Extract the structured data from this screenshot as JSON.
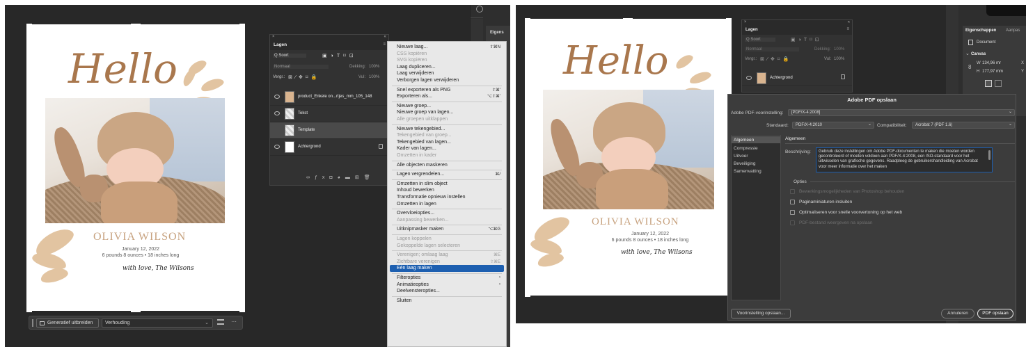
{
  "left_screen": {
    "artboard": {
      "hello": "Hello",
      "name": "OLIVIA WILSON",
      "date": "January 12, 2022",
      "details": "6 pounds 8 ounces • 18 inches long",
      "signature": "with love, The Wilsons"
    },
    "layers_panel": {
      "tab": "Lagen",
      "kind_filter": "Q Soort",
      "blend_mode": "Normaal",
      "opacity_label": "Dekking:",
      "opacity_value": "100%",
      "lock_label": "Vergr.:",
      "fill_label": "Vul:",
      "fill_value": "100%",
      "layers": [
        {
          "name": "product_Enkele on...rtjes_mm_105_148"
        },
        {
          "name": "Tekst"
        },
        {
          "name": "Template"
        },
        {
          "name": "Achtergrond"
        }
      ]
    },
    "context_menu": {
      "items": [
        {
          "label": "Nieuwe laag...",
          "shortcut": "⇧⌘N",
          "disabled": false
        },
        {
          "label": "CSS kopiëren",
          "shortcut": "",
          "disabled": true
        },
        {
          "label": "SVG kopiëren",
          "shortcut": "",
          "disabled": true
        },
        {
          "label": "Laag dupliceren...",
          "shortcut": "",
          "disabled": false
        },
        {
          "label": "Laag verwijderen",
          "shortcut": "",
          "disabled": false
        },
        {
          "label": "Verborgen lagen verwijderen",
          "shortcut": "",
          "disabled": false
        },
        {
          "label": "Snel exporteren als PNG",
          "shortcut": "⇧⌘'",
          "disabled": false
        },
        {
          "label": "Exporteren als...",
          "shortcut": "⌥⇧⌘'",
          "disabled": false
        },
        {
          "label": "Nieuwe groep...",
          "shortcut": "",
          "disabled": false
        },
        {
          "label": "Nieuwe groep van lagen...",
          "shortcut": "",
          "disabled": false
        },
        {
          "label": "Alle groepen uitklappen",
          "shortcut": "",
          "disabled": true
        },
        {
          "label": "Nieuwe tekengebied...",
          "shortcut": "",
          "disabled": false
        },
        {
          "label": "Tekengebied van groep...",
          "shortcut": "",
          "disabled": true
        },
        {
          "label": "Tekengebied van lagen...",
          "shortcut": "",
          "disabled": false
        },
        {
          "label": "Kader van lagen...",
          "shortcut": "",
          "disabled": false
        },
        {
          "label": "Omzetten in kader",
          "shortcut": "",
          "disabled": true
        },
        {
          "label": "Alle objecten maskeren",
          "shortcut": "",
          "disabled": false
        },
        {
          "label": "Lagen vergrendelen...",
          "shortcut": "⌘/",
          "disabled": false
        },
        {
          "label": "Omzetten in slim object",
          "shortcut": "",
          "disabled": false
        },
        {
          "label": "Inhoud bewerken",
          "shortcut": "",
          "disabled": false
        },
        {
          "label": "Transformatie opnieuw instellen",
          "shortcut": "",
          "disabled": false
        },
        {
          "label": "Omzetten in lagen",
          "shortcut": "",
          "disabled": false
        },
        {
          "label": "Overvloeiopties...",
          "shortcut": "",
          "disabled": false
        },
        {
          "label": "Aanpassing bewerken...",
          "shortcut": "",
          "disabled": true
        },
        {
          "label": "Uitknipmasker maken",
          "shortcut": "⌥⌘G",
          "disabled": false
        },
        {
          "label": "Lagen koppelen",
          "shortcut": "",
          "disabled": true
        },
        {
          "label": "Gekoppelde lagen selecteren",
          "shortcut": "",
          "disabled": true
        },
        {
          "label": "Verenigen; omlaag laag",
          "shortcut": "⌘E",
          "disabled": true
        },
        {
          "label": "Zichtbare verenigen",
          "shortcut": "⇧⌘E",
          "disabled": true
        },
        {
          "label": "Eén laag maken",
          "shortcut": "",
          "disabled": false
        },
        {
          "label": "Filteropties",
          "shortcut": "›",
          "disabled": false
        },
        {
          "label": "Animatieopties",
          "shortcut": "›",
          "disabled": false
        },
        {
          "label": "Deelvensteropties...",
          "shortcut": "",
          "disabled": false
        },
        {
          "label": "Sluiten",
          "shortcut": "",
          "disabled": false
        }
      ]
    },
    "taskbar": {
      "generative_label": "Generatief uitbreiden",
      "ratio_value": "Verhouding",
      "more": "···"
    },
    "side_tab": "Eigens"
  },
  "right_screen": {
    "properties": {
      "tab1": "Eigenschappen",
      "tab2": "Aanpas",
      "document_label": "Document",
      "canvas_label": "Canvas",
      "w_label": "W",
      "w_value": "134,96 mr",
      "h_label": "H",
      "h_value": "177,97 mm",
      "x_label": "X",
      "y_label": "Y"
    },
    "layers_panel": {
      "tab": "Lagen",
      "kind_filter": "Q Soort",
      "blend_mode": "Normaal",
      "opacity_label": "Dekking:",
      "opacity_value": "100%",
      "lock_label": "Vergr.:",
      "fill_label": "Vul:",
      "fill_value": "100%",
      "layer": "Achtergrond"
    },
    "dialog": {
      "title": "Adobe PDF opslaan",
      "preset_label": "Adobe PDF-voorinstelling:",
      "preset_value": "[PDF/X-4:2008]",
      "standard_label": "Standaard:",
      "standard_value": "PDF/X-4:2010",
      "compat_label": "Compatibiliteit:",
      "compat_value": "Acrobat 7 (PDF 1.6)",
      "sidebar": [
        "Algemeen",
        "Compressie",
        "Uitvoer",
        "Beveiliging",
        "Samenvatting"
      ],
      "section_title": "Algemeen",
      "description_label": "Beschrijving:",
      "description": "Gebruik deze instellingen om Adobe PDF-documenten te maken die moeten worden gecontroleerd of moeten voldoen aan PDF/X-4:2008, een ISO-standaard voor het uitwisselen van grafische gegevens. Raadpleeg de gebruikershandleiding van Acrobat voor meer informatie over het maken",
      "options_title": "Opties",
      "options": [
        {
          "label": "Bewerkingsmogelijkheden van Photoshop behouden",
          "disabled": true
        },
        {
          "label": "Paginaminiaturen insluiten",
          "disabled": false
        },
        {
          "label": "Optimaliseren voor snelle voorvertoning op het web",
          "disabled": false
        },
        {
          "label": "PDF-bestand weergeven na opslaan",
          "disabled": true
        }
      ],
      "save_preset_button": "Voorinstelling opslaan...",
      "cancel_button": "Annuleren",
      "save_button": "PDF opslaan"
    },
    "artboard": {
      "hello": "Hello",
      "name": "OLIVIA WILSON",
      "date": "January 12, 2022",
      "details": "6 pounds 8 ounces • 18 inches long",
      "signature": "with love, The Wilsons"
    }
  },
  "colors": {
    "app_bg": "#282828",
    "panel_bg": "#323232",
    "accent": "#1d5fb0",
    "brown": "#a9774d",
    "leaf": "#e2c4a1"
  }
}
